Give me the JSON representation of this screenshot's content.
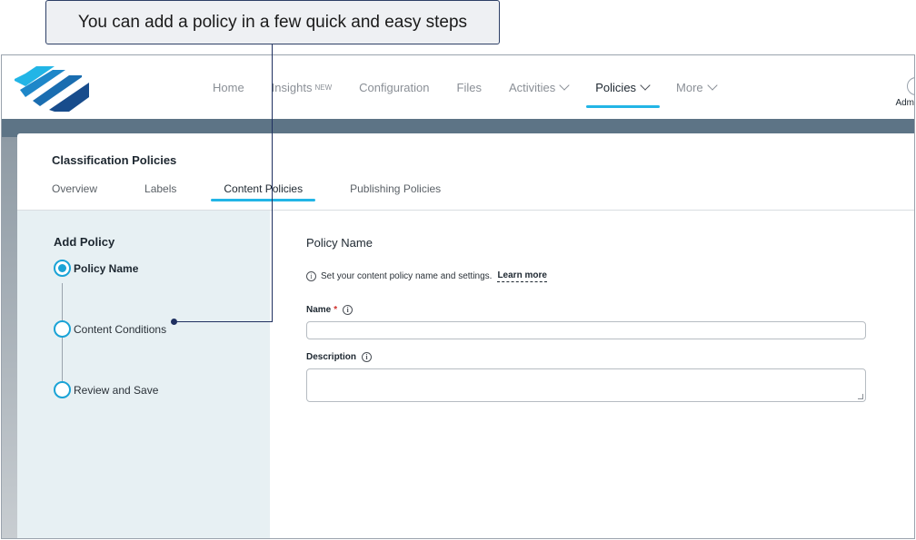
{
  "callout": {
    "text": "You can add a policy in a few quick and easy steps"
  },
  "header": {
    "nav": [
      {
        "label": "Home"
      },
      {
        "label": "Insights",
        "badge": "NEW"
      },
      {
        "label": "Configuration"
      },
      {
        "label": "Files"
      },
      {
        "label": "Activities"
      },
      {
        "label": "Policies"
      },
      {
        "label": "More"
      }
    ],
    "user_partial": "Adm"
  },
  "page": {
    "title": "Classification Policies",
    "tabs": [
      {
        "label": "Overview"
      },
      {
        "label": "Labels"
      },
      {
        "label": "Content Policies"
      },
      {
        "label": "Publishing Policies"
      }
    ]
  },
  "wizard": {
    "title": "Add Policy",
    "steps": [
      {
        "label": "Policy Name"
      },
      {
        "label": "Content Conditions"
      },
      {
        "label": "Review and Save"
      }
    ]
  },
  "form": {
    "title": "Policy Name",
    "info": "Set your content policy name and settings.",
    "learn_more": "Learn more",
    "name_label": "Name",
    "required_mark": "*",
    "name_value": "",
    "description_label": "Description",
    "description_value": ""
  },
  "colors": {
    "accent": "#22b5e6",
    "step_accent": "#1aa3d6",
    "band": "#5d7486",
    "panel": "#e7f0f3",
    "callout_border": "#2d3f66"
  },
  "icons": {
    "logo": "brand-logo",
    "info": "info-icon",
    "chevron": "chevron-down-icon"
  }
}
